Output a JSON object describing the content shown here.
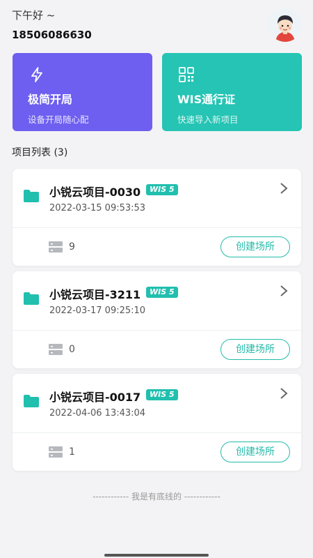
{
  "header": {
    "greeting": "下午好 ~",
    "phone": "18506086630",
    "avatar_icon": "cartoon-avatar"
  },
  "tiles": [
    {
      "title": "极简开局",
      "subtitle": "设备开局随心配",
      "icon": "lightning-icon",
      "color": "#6e5ff0"
    },
    {
      "title": "WIS通行证",
      "subtitle": "快速导入新项目",
      "icon": "qr-code-icon",
      "color": "#25c4b4"
    }
  ],
  "project_list": {
    "title": "项目列表 (3)",
    "items": [
      {
        "name": "小锐云项目-0030",
        "badge": "WIS 5",
        "date": "2022-03-15 09:53:53",
        "count": "9",
        "button": "创建场所"
      },
      {
        "name": "小锐云项目-3211",
        "badge": "WIS 5",
        "date": "2022-03-17 09:25:10",
        "count": "0",
        "button": "创建场所"
      },
      {
        "name": "小锐云项目-0017",
        "badge": "WIS 5",
        "date": "2022-04-06 13:43:04",
        "count": "1",
        "button": "创建场所"
      }
    ]
  },
  "footer": {
    "note": "------------ 我是有底线的 ------------"
  },
  "colors": {
    "accent": "#22bba9",
    "purple": "#6e5ff0",
    "background": "#f3f3f5"
  }
}
